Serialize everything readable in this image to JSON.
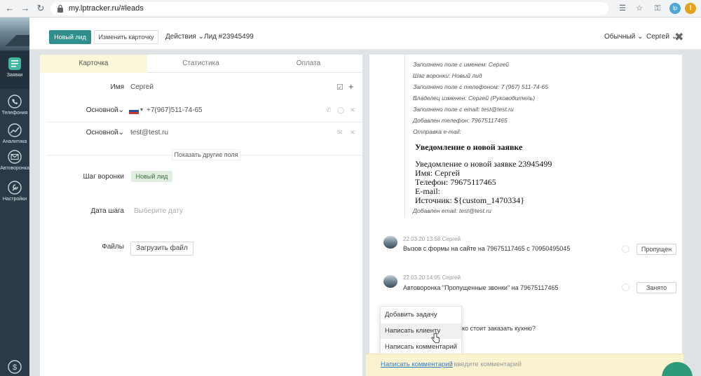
{
  "browser": {
    "url": "my.lptracker.ru/#leads",
    "profile_initials": "lp",
    "alert_symbol": "!"
  },
  "sidebar": {
    "items": [
      {
        "label": "Заявки",
        "icon": "leads-icon"
      },
      {
        "label": "Телефония",
        "icon": "phone-icon"
      },
      {
        "label": "Аналитика",
        "icon": "analytics-icon"
      },
      {
        "label": "Автоворонка",
        "icon": "mail-icon"
      },
      {
        "label": "Настройки",
        "icon": "settings-icon"
      }
    ]
  },
  "topbar": {
    "new_lead": "Новый лид",
    "edit_card": "Изменить карточку",
    "actions": "Действия",
    "lead_title": "Лид #23945499",
    "view_mode": "Обычный",
    "user": "Сергей"
  },
  "tabs": [
    "Карточка",
    "Статистика",
    "Оплата"
  ],
  "card": {
    "name_label": "Имя",
    "name_value": "Сергей",
    "phone_label": "Основной",
    "phone_value": "+7(967)511-74-65",
    "email_label": "Основной",
    "email_value": "test@test.ru",
    "show_more": "Показать другие поля",
    "stage_label": "Шаг воронки",
    "stage_value": "Новый лид",
    "date_label": "Дата шага",
    "date_placeholder": "Выберите дату",
    "files_label": "Файлы",
    "upload_button": "Загрузить файл"
  },
  "history": {
    "lines": [
      "Заполнено поле с именем: Сергей",
      "Шаг воронки: Новый лид",
      "Заполнено поле с телефоном: 7 (967) 511-74-65",
      "Владелец изменен: Сергей (Руководитель)",
      "Заполнено поле с email: test@test.ru",
      "Добавлен телефон: 79675117465",
      "Отправка e-mail:"
    ],
    "email_title": "Уведомление о новой заявке",
    "email_lines": [
      "Уведомление о новой заявке 23945499",
      "Имя: Сергей",
      "Телефон: 79675117465",
      "E-mail:",
      "Источник: ${custom_1470334}"
    ],
    "email_added": "Добавлен email: test@test.ru"
  },
  "messages": [
    {
      "meta": "22.03.20 13:58  Сергей",
      "text": "Вызов с формы на сайте на 79675117465 с 70950495045",
      "status": "Пропущен"
    },
    {
      "meta": "22.03.20 14:05  Сергей",
      "text": "Автоворонка \"Пропущенные звонки\" на 79675117465",
      "status": "Занято"
    }
  ],
  "partial_text": "ко стоит заказать кухню?",
  "dropdown": [
    "Добавить задачу",
    "Написать клиенту",
    "Написать комментарий"
  ],
  "comment": {
    "link": "Написать комментарий",
    "hint": ": введите комментарий"
  },
  "colors": {
    "accent": "#2f8f8c",
    "sidebar_bg": "#2a3b47",
    "tab_active_bg": "#fbf7d9",
    "comment_bar_bg": "#fbf3cf"
  }
}
